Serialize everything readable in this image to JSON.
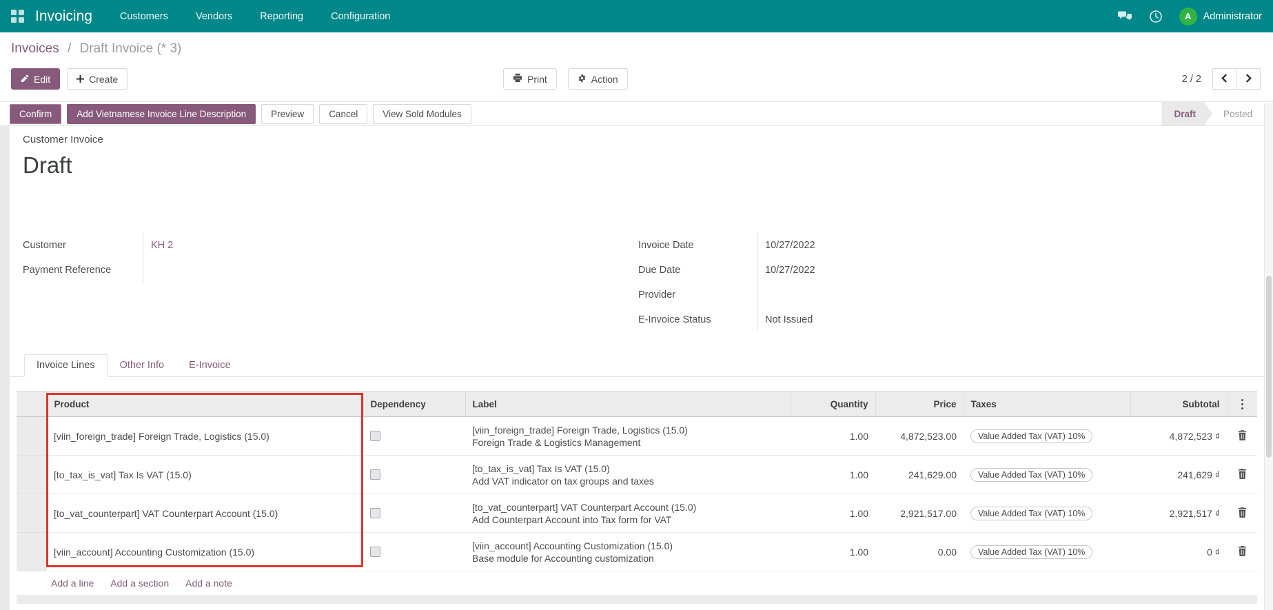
{
  "topbar": {
    "app_name": "Invoicing",
    "menus": [
      "Customers",
      "Vendors",
      "Reporting",
      "Configuration"
    ],
    "user": {
      "name": "Administrator",
      "avatar_initial": "A",
      "avatar_color": "#30b445"
    },
    "bar_color": "#00878a"
  },
  "breadcrumb": {
    "parent": "Invoices",
    "separator": "/",
    "current": "Draft Invoice (* 3)"
  },
  "control_panel": {
    "edit_label": "Edit",
    "create_label": "Create",
    "print_label": "Print",
    "action_label": "Action",
    "pager": {
      "value": "2 / 2"
    }
  },
  "statusbar": {
    "confirm_label": "Confirm",
    "add_vietnamese_label": "Add Vietnamese Invoice Line Description",
    "preview_label": "Preview",
    "cancel_label": "Cancel",
    "view_sold_modules_label": "View Sold Modules",
    "states": {
      "draft": "Draft",
      "posted": "Posted"
    }
  },
  "document": {
    "type_label": "Customer Invoice",
    "title": "Draft",
    "left_fields": [
      {
        "label": "Customer",
        "value": "KH 2"
      },
      {
        "label": "Payment Reference",
        "value": ""
      }
    ],
    "right_fields": [
      {
        "label": "Invoice Date",
        "value": "10/27/2022"
      },
      {
        "label": "Due Date",
        "value": "10/27/2022"
      },
      {
        "label": "Provider",
        "value": ""
      },
      {
        "label": "E-Invoice Status",
        "value": "Not Issued"
      }
    ]
  },
  "tabs": [
    {
      "label": "Invoice Lines",
      "active": true
    },
    {
      "label": "Other Info",
      "active": false
    },
    {
      "label": "E-Invoice",
      "active": false
    }
  ],
  "invoice_lines": {
    "columns": {
      "product": "Product",
      "dependency": "Dependency",
      "label": "Label",
      "quantity": "Quantity",
      "price": "Price",
      "taxes": "Taxes",
      "subtotal": "Subtotal"
    },
    "rows": [
      {
        "product": "[viin_foreign_trade] Foreign Trade, Logistics (15.0)",
        "dependency_checked": false,
        "label_line1": "[viin_foreign_trade] Foreign Trade, Logistics (15.0)",
        "label_line2": "Foreign Trade & Logistics Management",
        "quantity": "1.00",
        "price": "4,872,523.00",
        "taxes": "Value Added Tax (VAT) 10%",
        "subtotal": "4,872,523 ₫"
      },
      {
        "product": "[to_tax_is_vat] Tax Is VAT (15.0)",
        "dependency_checked": false,
        "label_line1": "[to_tax_is_vat] Tax Is VAT (15.0)",
        "label_line2": "Add VAT indicator on tax groups and taxes",
        "quantity": "1.00",
        "price": "241,629.00",
        "taxes": "Value Added Tax (VAT) 10%",
        "subtotal": "241,629 ₫"
      },
      {
        "product": "[to_vat_counterpart] VAT Counterpart Account (15.0)",
        "dependency_checked": false,
        "label_line1": "[to_vat_counterpart] VAT Counterpart Account (15.0)",
        "label_line2": "Add Counterpart Account into Tax form for VAT",
        "quantity": "1.00",
        "price": "2,921,517.00",
        "taxes": "Value Added Tax (VAT) 10%",
        "subtotal": "2,921,517 ₫"
      },
      {
        "product": "[viin_account] Accounting Customization (15.0)",
        "dependency_checked": false,
        "label_line1": "[viin_account] Accounting Customization (15.0)",
        "label_line2": "Base module for Accounting customization",
        "quantity": "1.00",
        "price": "0.00",
        "taxes": "Value Added Tax (VAT) 10%",
        "subtotal": "0 ₫"
      }
    ],
    "footer_links": [
      "Add a line",
      "Add a section",
      "Add a note"
    ]
  },
  "annotation": {
    "shape": "rectangle",
    "color": "#e0342c",
    "highlights": "Product column"
  }
}
